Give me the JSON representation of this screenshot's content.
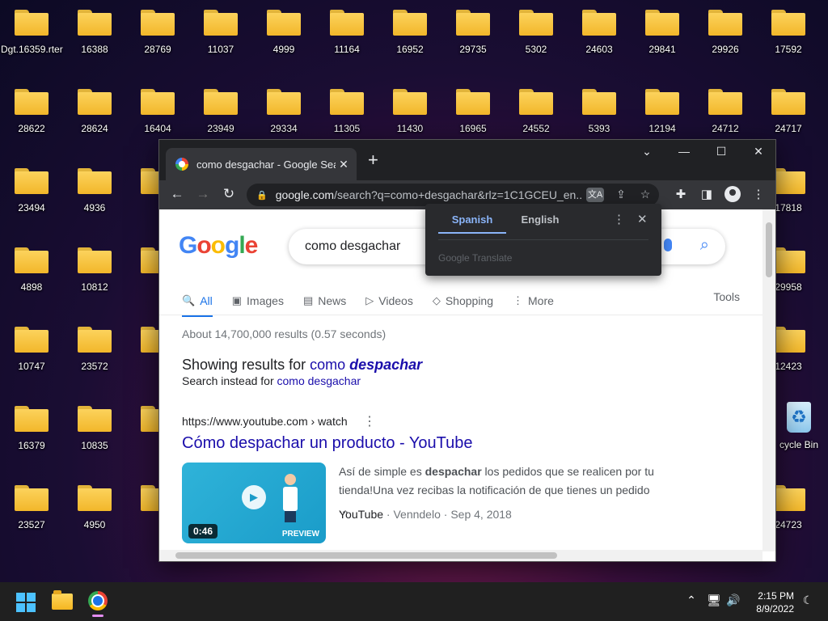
{
  "desktop": {
    "icons": [
      "Dgt.16359.rter",
      "16388",
      "28769",
      "11037",
      "4999",
      "11164",
      "16952",
      "29735",
      "5302",
      "24603",
      "29841",
      "29926",
      "17592",
      "28622",
      "28624",
      "16404",
      "23949",
      "29334",
      "11305",
      "11430",
      "16965",
      "24552",
      "5393",
      "12194",
      "24712",
      "24717",
      "23494",
      "4936",
      "17818",
      "4898",
      "10812",
      "29958",
      "10747",
      "23572",
      "12423",
      "16379",
      "10835",
      "23527",
      "4950",
      "24723"
    ],
    "recycle_bin_label": "cycle Bin"
  },
  "chrome": {
    "tab_title": "como desgachar - Google Search",
    "url_host": "google.com",
    "url_rest": "/search?q=como+desgachar&rlz=1C1GCEU_en...",
    "translate_popup": {
      "tab_source": "Spanish",
      "tab_target": "English",
      "brand": "Google Translate"
    }
  },
  "google": {
    "logo": "Google",
    "query": "como desgachar",
    "tabs": [
      {
        "icon": "🔍",
        "label": "All"
      },
      {
        "icon": "▣",
        "label": "Images"
      },
      {
        "icon": "▤",
        "label": "News"
      },
      {
        "icon": "▷",
        "label": "Videos"
      },
      {
        "icon": "◇",
        "label": "Shopping"
      },
      {
        "icon": "⋮",
        "label": "More"
      }
    ],
    "tools_label": "Tools",
    "stats": "About 14,700,000 results (0.57 seconds)",
    "showing_prefix": "Showing results for ",
    "showing_plain": "como ",
    "showing_corrected": "despachar",
    "instead_prefix": "Search instead for ",
    "instead_link": "como desgachar",
    "result": {
      "cite": "https://www.youtube.com › watch",
      "title": "Cómo despachar un producto - YouTube",
      "duration": "0:46",
      "preview": "PREVIEW",
      "snippet_1": "Así de simple es ",
      "snippet_bold": "despachar",
      "snippet_2": " los pedidos que se realicen por tu tienda!Una vez recibas la notificación de que tienes un pedido ...",
      "source": "YouTube",
      "channel": "Venndelo",
      "date": "Sep 4, 2018"
    }
  },
  "taskbar": {
    "time": "2:15 PM",
    "date": "8/9/2022"
  }
}
